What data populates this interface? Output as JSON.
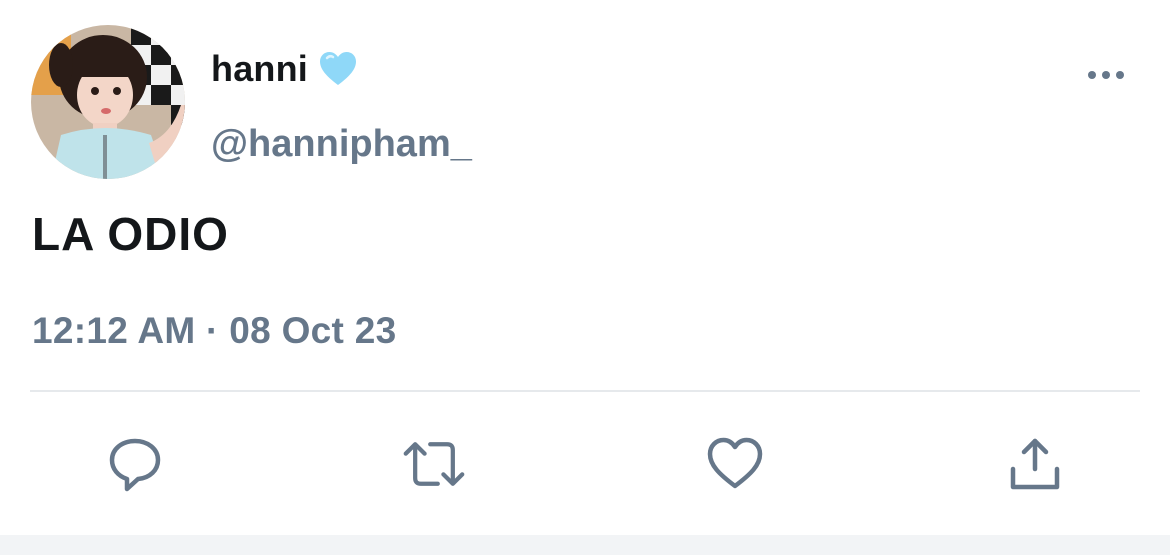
{
  "tweet": {
    "display_name": "hanni",
    "handle": "@hannipham_",
    "text": "LA ODIO",
    "timestamp": "12:12 AM · 08 Oct 23",
    "verified_emoji": "light-blue-heart-emoji"
  },
  "icons": {
    "more": "more-horizontal-icon",
    "reply": "reply-bubble-icon",
    "retweet": "retweet-icon",
    "like": "heart-icon",
    "share": "share-upload-icon"
  },
  "colors": {
    "text_primary": "#14171a",
    "text_secondary": "#66778a",
    "icon": "#66778a",
    "divider": "#e6e9ec",
    "heart_emoji": "#8fd8f8"
  }
}
